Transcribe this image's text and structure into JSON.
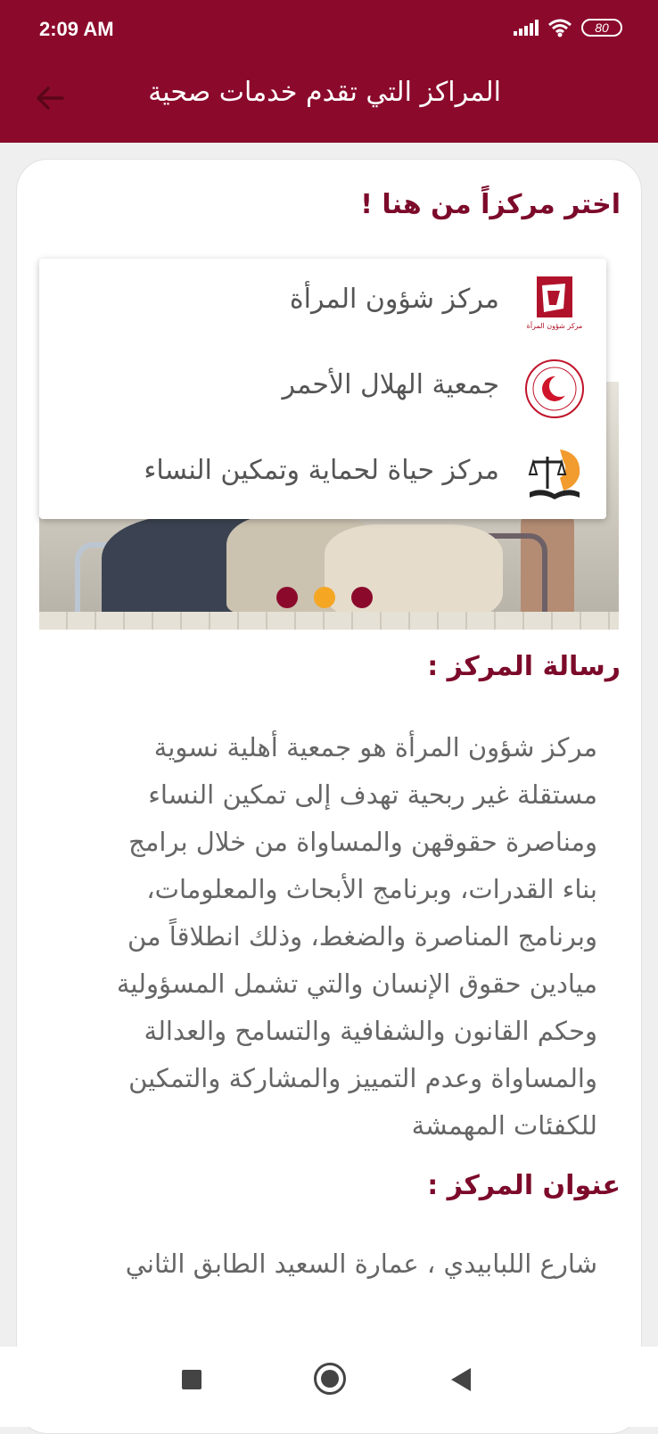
{
  "status_bar": {
    "time": "2:09 AM",
    "battery": "80"
  },
  "app_bar": {
    "title": "المراكز التي تقدم خدمات صحية",
    "back_icon": "arrow-left-icon"
  },
  "colors": {
    "primary": "#8b0a2c",
    "heading": "#7c0a2a",
    "dot_active": "#f5a623",
    "dot_inactive": "#8b0a2c"
  },
  "picker": {
    "heading": "اختر مركزاً من هنا !",
    "options": [
      {
        "label": "مركز شؤون المرأة",
        "logo": "womens-affairs-logo",
        "logo_caption": "مركز شؤون المرأة"
      },
      {
        "label": "جمعية الهلال الأحمر",
        "logo": "red-crescent-logo"
      },
      {
        "label": "مركز حياة لحماية وتمكين النساء",
        "logo": "hayat-center-logo"
      }
    ]
  },
  "carousel": {
    "slides": 3,
    "active_index": 1
  },
  "message": {
    "heading": "رسالة المركز :",
    "lines": [
      "مركز شؤون المرأة هو جمعية أهلية نسوية",
      "مستقلة غير ربحية تهدف إلى تمكين النساء",
      "ومناصرة حقوقهن والمساواة من خلال برامج",
      "بناء القدرات، وبرنامج الأبحاث والمعلومات،",
      "وبرنامج المناصرة والضغط، وذلك انطلاقاً من",
      "ميادين حقوق الإنسان والتي تشمل المسؤولية",
      "وحكم القانون والشفافية والتسامح والعدالة",
      "والمساواة وعدم التمييز والمشاركة والتمكين",
      "للكفئات المهمشة"
    ]
  },
  "address": {
    "heading": "عنوان المركز :",
    "value": "شارع اللبابيدي ، عمارة السعيد الطابق الثاني"
  },
  "nav_bar": {
    "recents_icon": "square-icon",
    "home_icon": "circle-home-icon",
    "back_icon": "triangle-back-icon"
  }
}
